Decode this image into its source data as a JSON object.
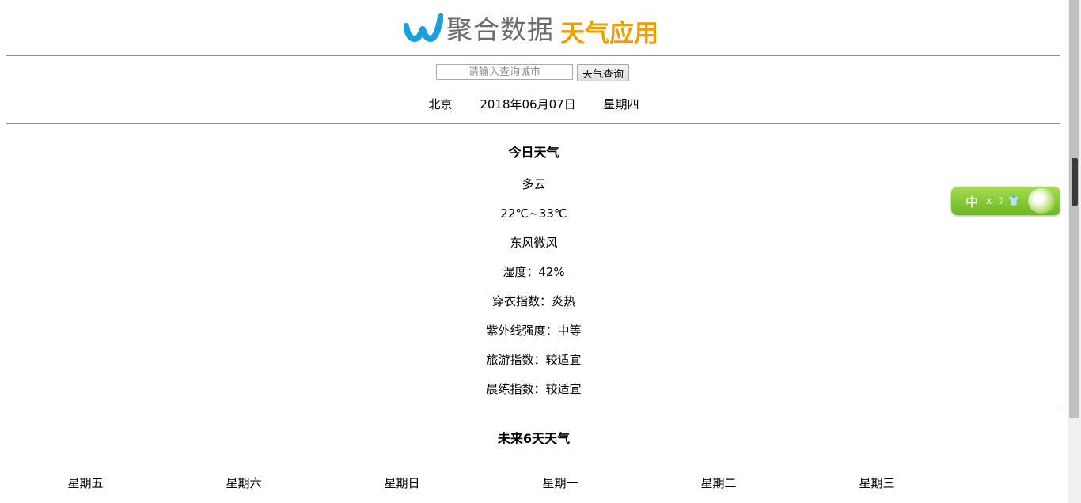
{
  "header": {
    "brand": "聚合数据",
    "app_name": "天气应用",
    "brand_color": "#6b6b6b",
    "app_color": "#f39c00",
    "logo_color": "#1aa0e0"
  },
  "search": {
    "placeholder": "请输入查询城市",
    "button_label": "天气查询"
  },
  "location": {
    "city": "北京",
    "date": "2018年06月07日",
    "weekday": "星期四"
  },
  "today": {
    "title": "今日天气",
    "items": [
      "多云",
      "22℃~33℃",
      "东风微风",
      "湿度：42%",
      "穿衣指数：炎热",
      "紫外线强度：中等",
      "旅游指数：较适宜",
      "晨练指数：较适宜"
    ]
  },
  "forecast": {
    "title": "未来6天天气",
    "days": [
      "星期五",
      "星期六",
      "星期日",
      "星期一",
      "星期二",
      "星期三"
    ]
  },
  "widget": {
    "label": "中",
    "icons": "ⅹ☽👕"
  }
}
